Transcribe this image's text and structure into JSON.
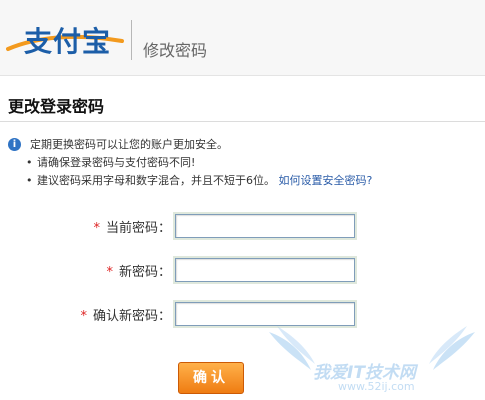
{
  "header": {
    "logo_text": "支付宝",
    "section_title": "修改密码"
  },
  "page": {
    "title": "更改登录密码"
  },
  "tips": {
    "main": "定期更换密码可以让您的账户更加安全。",
    "items": [
      {
        "text": "请确保登录密码与支付密码不同!"
      },
      {
        "text": "建议密码采用字母和数字混合，并且不短于6位。",
        "link": "如何设置安全密码?"
      }
    ]
  },
  "form": {
    "required_mark": "*",
    "fields": [
      {
        "label": "当前密码：",
        "value": ""
      },
      {
        "label": "新密码：",
        "value": ""
      },
      {
        "label": "确认新密码：",
        "value": ""
      }
    ],
    "submit_label": "确认"
  },
  "watermark": {
    "main": "我爱IT技术网",
    "sub": "www.52ij.com"
  },
  "colors": {
    "brand_blue": "#1c5ea8",
    "link_blue": "#2b5ca8",
    "required_red": "#dd2222",
    "button_orange": "#f58f23"
  }
}
